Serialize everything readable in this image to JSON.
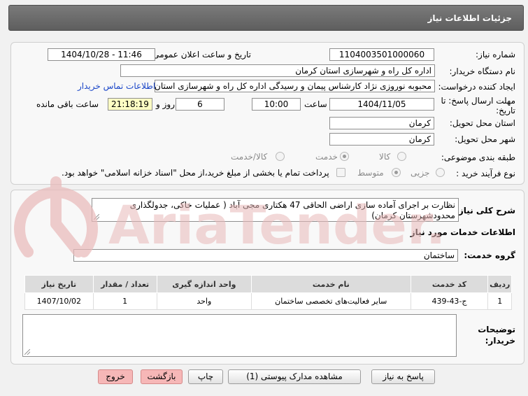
{
  "header": {
    "title": "جزئیات اطلاعات نیاز"
  },
  "form": {
    "need_number": {
      "label": "شماره نیاز:",
      "value": "1104003501000060"
    },
    "announce_datetime": {
      "label": "تاریخ و ساعت اعلان عمومی:",
      "value": "1404/10/28 - 11:46"
    },
    "buyer_org": {
      "label": "نام دستگاه خریدار:",
      "value": "اداره کل راه و شهرسازی استان کرمان"
    },
    "requester": {
      "label": "ایجاد کننده درخواست:",
      "value": "محبوبه نوروزی نژاد کارشناس پیمان و رسیدگی اداره کل راه و شهرسازی استان",
      "contact_link": "اطلاعات تماس خریدار"
    },
    "deadline": {
      "label_line1": "مهلت ارسال پاسخ: تا",
      "label_line2": "تاریخ:",
      "date": "1404/11/05",
      "time_label": "ساعت",
      "time": "10:00",
      "days": "6",
      "days_label": "روز و",
      "remaining": "21:18:19",
      "remaining_label": "ساعت باقی مانده"
    },
    "delivery_province": {
      "label": "استان محل تحویل:",
      "value": "کرمان"
    },
    "delivery_city": {
      "label": "شهر محل تحویل:",
      "value": "کرمان"
    },
    "category": {
      "label": "طبقه بندی موضوعی:",
      "options": [
        "کالا",
        "خدمت",
        "کالا/خدمت"
      ],
      "selected": "خدمت"
    },
    "process": {
      "label": "نوع فرآیند خرید :",
      "options": [
        "جزیی",
        "متوسط"
      ],
      "selected": "متوسط",
      "payment_note": "پرداخت تمام یا بخشی از مبلغ خرید،از محل \"اسناد خزانه اسلامی\" خواهد بود."
    }
  },
  "details": {
    "summary_label": "شرح کلی نیاز:",
    "summary_text": "نظارت بر اجرای آماده سازی اراضی الحاقی 47 هکتاری مجی آباد ( عملیات خاکی، جدولگذاری محدودشهرستان کرمان)",
    "services_title": "اطلاعات خدمات مورد نیاز",
    "service_group_label": "گروه خدمت:",
    "service_group": "ساختمان",
    "table": {
      "headers": [
        "ردیف",
        "کد خدمت",
        "نام خدمت",
        "واحد اندازه گیری",
        "تعداد / مقدار",
        "تاریخ نیاز"
      ],
      "rows": [
        [
          "1",
          "ج-43-439",
          "سایر فعالیت‌های تخصصی ساختمان",
          "واحد",
          "1",
          "1407/10/02"
        ]
      ]
    },
    "buyer_notes_label_line1": "توضیحات",
    "buyer_notes_label_line2": "خریدار:",
    "buyer_notes": ""
  },
  "buttons": {
    "reply": "پاسخ به نیاز",
    "attachments": "مشاهده مدارک پیوستی (1)",
    "print": "چاپ",
    "back": "بازگشت",
    "exit": "خروج"
  },
  "watermark": {
    "text": "AriaTender.net",
    "color": "#e9b9b9"
  }
}
